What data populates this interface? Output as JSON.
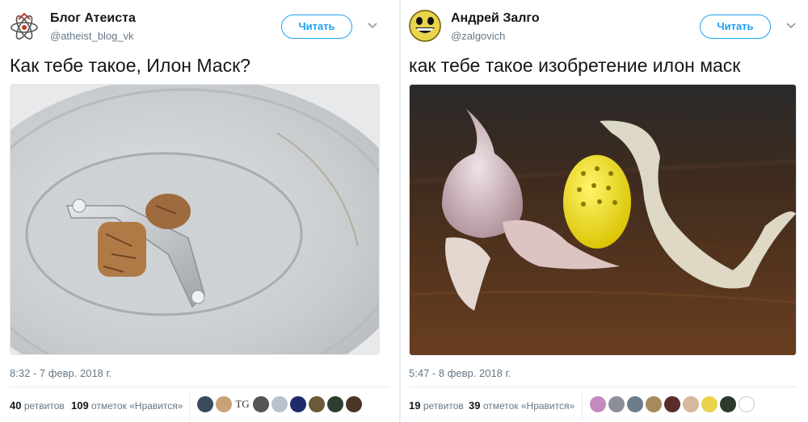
{
  "tweets": [
    {
      "author_name": "Блог Атеиста",
      "handle": "@atheist_blog_vk",
      "follow_label": "Читать",
      "text": "Как тебе такое, Илон Маск?",
      "timestamp": "8:32 - 7 февр. 2018 г.",
      "retweets_count": "40",
      "retweets_label": "ретвитов",
      "likes_count": "109",
      "likes_label": "отметок «Нравится»",
      "liker_text": "TG"
    },
    {
      "author_name": "Андрей Залго",
      "handle": "@zalgovich",
      "follow_label": "Читать",
      "text": "как тебе такое изобретение илон маск",
      "timestamp": "5:47 - 8 февр. 2018 г.",
      "retweets_count": "19",
      "retweets_label": "ретвитов",
      "likes_count": "39",
      "likes_label": "отметок «Нравится»"
    }
  ],
  "colors": {
    "accent": "#1da1f2",
    "secondary_text": "#657786",
    "divider": "#e6ecf0"
  }
}
